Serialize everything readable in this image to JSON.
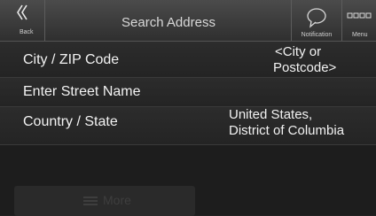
{
  "header": {
    "back_label": "Back",
    "title": "Search Address",
    "notification_label": "Notification",
    "menu_label": "Menu"
  },
  "rows": [
    {
      "label": "City / ZIP Code",
      "value_line1": "<City or",
      "value_line2": "Postcode>"
    },
    {
      "label": "Enter Street Name"
    },
    {
      "label": "Country / State",
      "value_line1": "United States,",
      "value_line2": "District of Columbia"
    }
  ],
  "footer": {
    "more_label": "More"
  },
  "icons": {
    "back": "double-chevron-left-icon",
    "notification": "speech-bubble-icon",
    "menu": "menu-squares-icon"
  }
}
